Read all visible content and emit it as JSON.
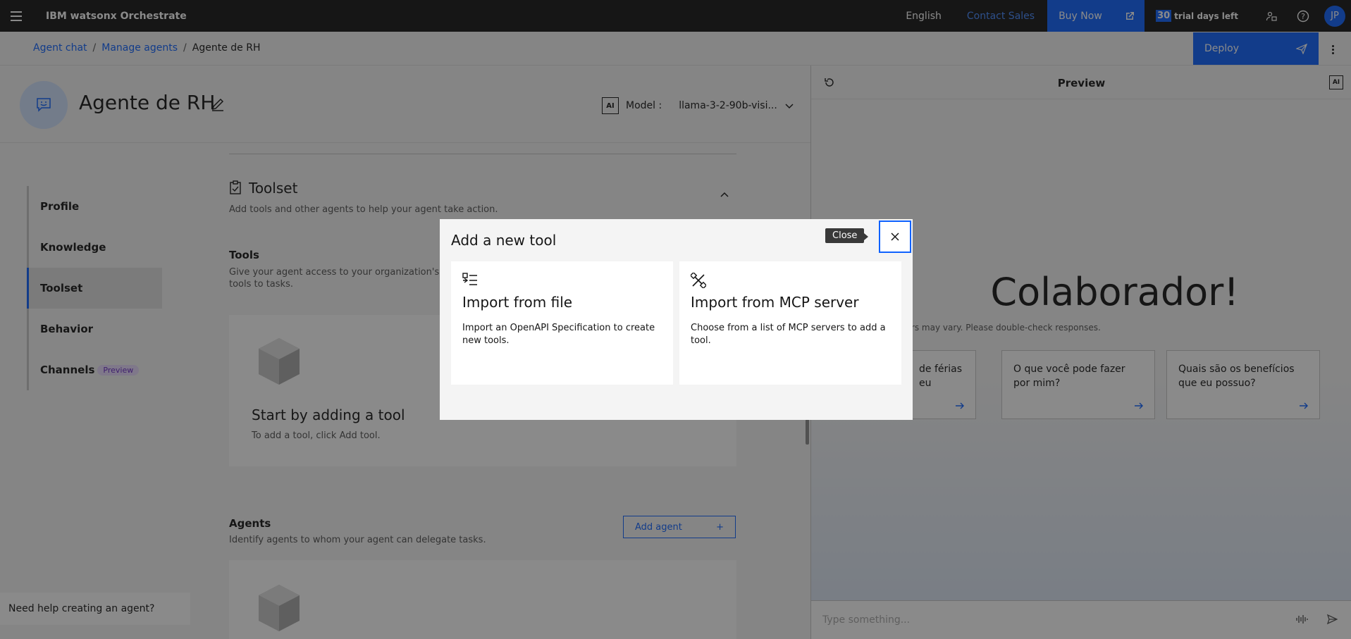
{
  "header": {
    "brand": "IBM watsonx Orchestrate",
    "language": "English",
    "contact": "Contact Sales",
    "buy_now": "Buy Now",
    "trial_days": "30",
    "trial_text": "trial days left",
    "avatar_initials": "JP"
  },
  "breadcrumb": {
    "items": [
      "Agent chat",
      "Manage agents",
      "Agente de RH"
    ],
    "sep": "/"
  },
  "deploy": {
    "label": "Deploy"
  },
  "agent": {
    "title": "Agente de RH",
    "ai_badge": "AI",
    "model_label": "Model :",
    "model_value": "llama-3-2-90b-visi..."
  },
  "nav": {
    "items": [
      {
        "label": "Profile"
      },
      {
        "label": "Knowledge"
      },
      {
        "label": "Toolset"
      },
      {
        "label": "Behavior"
      },
      {
        "label": "Channels"
      }
    ],
    "preview_tag": "Preview"
  },
  "toolset": {
    "title": "Toolset",
    "description": "Add tools and other agents to help your agent take action.",
    "tools_heading": "Tools",
    "tools_desc": "Give your agent access to your organization's tools to tasks.",
    "start_heading": "Start by adding a tool",
    "start_desc": "To add a tool, click Add tool.",
    "agents_heading": "Agents",
    "agents_desc": "Identify agents to whom your agent can delegate tasks.",
    "add_agent": "Add agent",
    "add_plus": "+"
  },
  "help": {
    "label": "Need help creating an agent?"
  },
  "preview": {
    "title": "Preview",
    "ai_badge": "AI",
    "greeting": "Colaborador!",
    "disclaimer": "ted answers may vary. Please double-check responses.",
    "suggestions": [
      "de férias eu",
      "O que você pode fazer por mim?",
      "Quais são os benefícios que eu possuo?"
    ],
    "input_placeholder": "Type something..."
  },
  "modal": {
    "title": "Add a new tool",
    "close_tooltip": "Close",
    "options": [
      {
        "title": "Import from file",
        "description": "Import an OpenAPI Specification to create new tools.",
        "icon": "import-file-icon"
      },
      {
        "title": "Import from MCP server",
        "description": "Choose from a list of MCP servers to add a tool.",
        "icon": "mcp-server-icon"
      }
    ]
  },
  "colors": {
    "primary": "#0f62fe",
    "header_bg": "#161616",
    "overlay": "rgba(22,22,22,0.5)"
  }
}
